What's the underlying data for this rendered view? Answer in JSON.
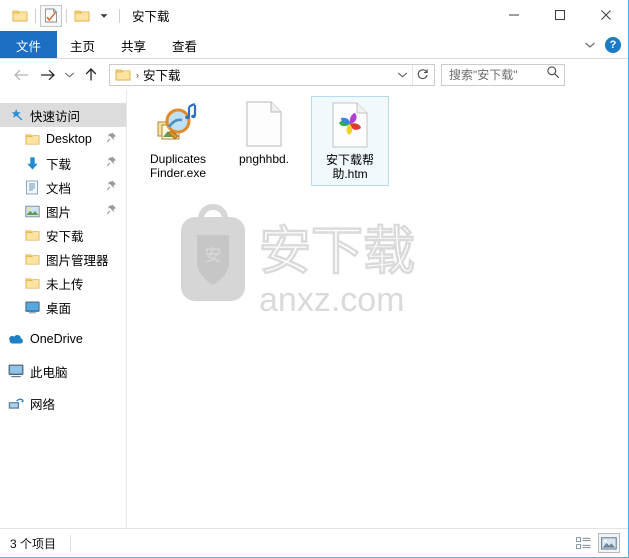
{
  "window": {
    "title": "安下载",
    "border_color": "#4cb4e7"
  },
  "quick_access_toolbar": {
    "items": [
      {
        "name": "folder-icon",
        "label": ""
      },
      {
        "name": "properties-icon",
        "label": ""
      },
      {
        "name": "new-folder-icon",
        "label": ""
      },
      {
        "name": "chevron-down-icon",
        "label": ""
      }
    ]
  },
  "window_controls": {
    "minimize": "—",
    "maximize": "□",
    "close": "✕"
  },
  "ribbon": {
    "accent_color": "#1b6ec2",
    "tabs": [
      {
        "label": "文件",
        "active": true
      },
      {
        "label": "主页",
        "active": false
      },
      {
        "label": "共享",
        "active": false
      },
      {
        "label": "查看",
        "active": false
      }
    ],
    "expand_label": "",
    "help_label": "?"
  },
  "navigation": {
    "back_label": "",
    "forward_label": "",
    "history_label": "",
    "up_label": "",
    "breadcrumb": {
      "folder_icon": "folder-icon",
      "separator": "›",
      "path": "安下载"
    },
    "address_dropdown": "",
    "refresh_label": "↻"
  },
  "search": {
    "placeholder": "搜索\"安下载\"",
    "value": "",
    "icon": "search-icon"
  },
  "sidebar": {
    "groups": [
      {
        "header": {
          "label": "快速访问",
          "icon": "pin-star-icon",
          "selected": true
        },
        "items": [
          {
            "label": "Desktop",
            "icon": "folder-icon",
            "pinned": true
          },
          {
            "label": "下载",
            "icon": "download-arrow-icon",
            "pinned": true
          },
          {
            "label": "文档",
            "icon": "documents-icon",
            "pinned": true
          },
          {
            "label": "图片",
            "icon": "pictures-icon",
            "pinned": true
          },
          {
            "label": "安下载",
            "icon": "folder-icon",
            "pinned": false
          },
          {
            "label": "图片管理器",
            "icon": "folder-icon",
            "pinned": false
          },
          {
            "label": "未上传",
            "icon": "folder-icon",
            "pinned": false
          },
          {
            "label": "桌面",
            "icon": "desktop-monitor-icon",
            "pinned": false
          }
        ]
      },
      {
        "header": {
          "label": "OneDrive",
          "icon": "cloud-icon",
          "selected": false
        },
        "items": []
      },
      {
        "header": {
          "label": "此电脑",
          "icon": "this-pc-icon",
          "selected": false
        },
        "items": []
      },
      {
        "header": {
          "label": "网络",
          "icon": "network-icon",
          "selected": false
        },
        "items": []
      }
    ]
  },
  "files": [
    {
      "name": "Duplicates Finder.exe",
      "icon": "duplicates-finder-app-icon",
      "selected": false
    },
    {
      "name": "pnghhbd.",
      "icon": "blank-document-icon",
      "selected": false
    },
    {
      "name": "安下载帮助.htm",
      "icon": "html-pinwheel-icon",
      "selected": true
    }
  ],
  "watermark": {
    "brand_text": "安下载",
    "url_text": "anxz.com",
    "shield_char": "安",
    "color": "#d4d4d4"
  },
  "statusbar": {
    "item_count_text": "3 个项目",
    "view_buttons": [
      {
        "name": "details-view-button",
        "active": false
      },
      {
        "name": "large-icons-view-button",
        "active": true
      }
    ]
  }
}
